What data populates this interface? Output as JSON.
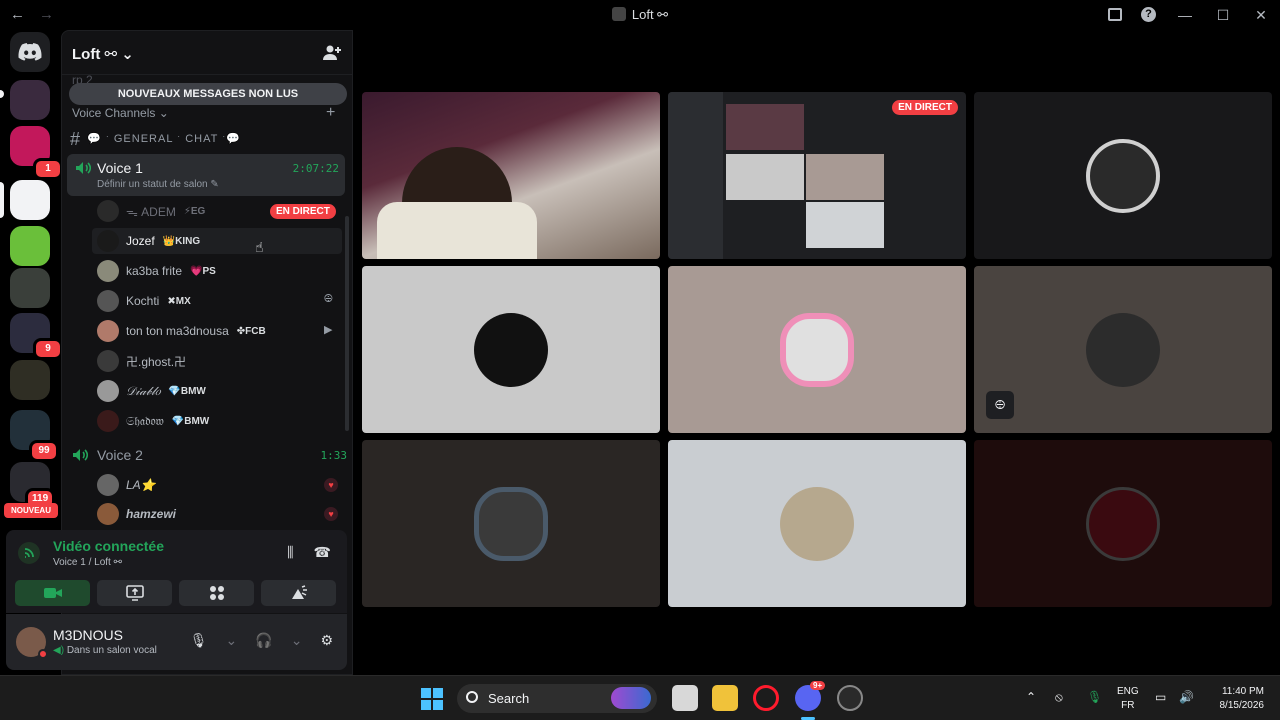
{
  "window": {
    "title": "Loft ⚯",
    "nav_back": "←",
    "nav_forward": "→",
    "minimize": "—",
    "maximize": "☐",
    "close": "✕"
  },
  "server": {
    "name": "Loft ⚯",
    "chevron": "⌄",
    "unread_banner": "NOUVEAUX MESSAGES NON LUS",
    "prev_channel": "rp 2",
    "category": "Voice Channels",
    "text_channel": "💬 ˑ GENERAL ˑ CHAT ˑ💬"
  },
  "rail": {
    "badges": [
      "1",
      "9",
      "99",
      "119"
    ],
    "nouveau": "NOUVEAU"
  },
  "voice1": {
    "name": "Voice 1",
    "timer": "2:07:22",
    "status": "Définir un statut de salon ✎",
    "members": [
      {
        "name": "ᯓ ADEM",
        "tag": "⚡EG",
        "live": "EN DIRECT"
      },
      {
        "name": "Jozef",
        "tag": "👑KING"
      },
      {
        "name": "ka3ba frite",
        "tag": "💗PS"
      },
      {
        "name": "Kochti",
        "tag": "✖MX"
      },
      {
        "name": "ton ton ma3dnousa",
        "tag": "✤FCB"
      },
      {
        "name": "卍.ghost.卍",
        "tag": ""
      },
      {
        "name": "𝒟𝒾𝒶𝒷𝓁𝑜",
        "tag": "💎BMW"
      },
      {
        "name": "𝔖𝔥𝔞𝔡𝔬𝔴",
        "tag": "💎BMW"
      }
    ]
  },
  "voice2": {
    "name": "Voice 2",
    "timer": "1:33",
    "members": [
      {
        "name": "LA⭐"
      },
      {
        "name": "hamzewi"
      }
    ]
  },
  "connection": {
    "title": "Vidéo connectée",
    "subtitle": "Voice 1 / Loft ⚯"
  },
  "user": {
    "name": "M3DNOUS",
    "status": "Dans un salon vocal"
  },
  "grid": {
    "live_label": "EN DIRECT"
  },
  "taskbar": {
    "search_label": "Search",
    "lang_top": "ENG",
    "lang_bottom": "FR",
    "time": "11:40 PM",
    "date": "8/15/2026",
    "discord_badge": "9+"
  },
  "colors": {
    "accent_green": "#23a55a",
    "live_red": "#f23f43",
    "windows_blue": "#4cc2ff"
  }
}
